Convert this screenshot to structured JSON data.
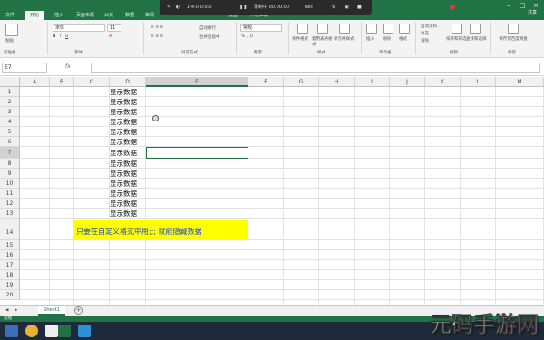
{
  "ribbon_tabs": [
    "文件",
    "开始",
    "插入",
    "页面布局",
    "公式",
    "数据",
    "审阅",
    "视图",
    "开发工具"
  ],
  "share_label": "共享",
  "recorder": {
    "time": "1:4:0:0:0:0",
    "status": "录制中 00:00:00",
    "mode": "Rec"
  },
  "ribbon": {
    "paste": "粘贴",
    "clipboard": "剪贴板",
    "font_name": "宋体",
    "font_size": "11",
    "font_group": "字体",
    "alignment_group": "对齐方式",
    "wrap_text": "自动换行",
    "merge": "合并后居中",
    "number_format": "常规",
    "number_group": "数字",
    "conditional": "条件格式",
    "table_format": "套用表格格式",
    "cell_styles": "单元格样式",
    "styles_group": "样式",
    "insert": "插入",
    "delete": "删除",
    "format": "格式",
    "cells_group": "单元格",
    "autosum": "自动求和",
    "fill": "填充",
    "clear": "清除",
    "sort_filter": "排序和筛选",
    "find_select": "查找和选择",
    "editing_group": "编辑",
    "save_cloud": "保存到百度网盘",
    "save_group": "保存"
  },
  "name_box": "E7",
  "fx_label": "fx",
  "columns": [
    "A",
    "B",
    "C",
    "D",
    "E",
    "F",
    "G",
    "H",
    "I",
    "J",
    "K",
    "L",
    "M"
  ],
  "rows": [
    "1",
    "2",
    "3",
    "4",
    "5",
    "6",
    "7",
    "8",
    "9",
    "10",
    "11",
    "12",
    "13",
    "14",
    "15",
    "16",
    "17",
    "18",
    "19",
    "20"
  ],
  "column_d_text": "显示数据",
  "highlight_text": "只要在自定义格式中用;;;  就能隐藏数据",
  "sheet_tab": "Sheet1",
  "status_text": "就绪",
  "watermark": "元码手游网",
  "colors": {
    "excel_green": "#217346",
    "highlight": "#ffff00",
    "highlight_text": "#2046c8"
  }
}
